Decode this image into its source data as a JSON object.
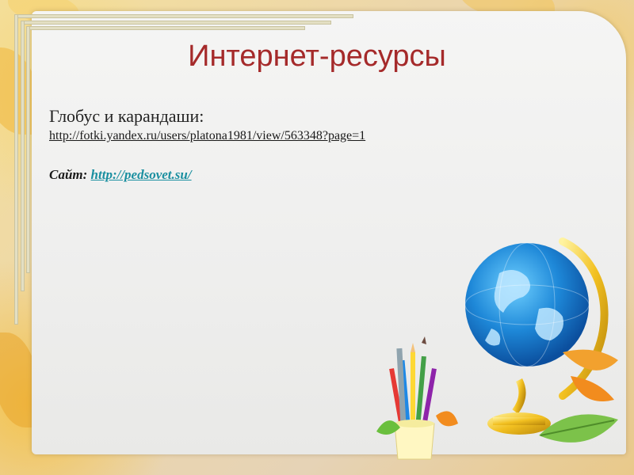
{
  "slide": {
    "title": "Интернет-ресурсы",
    "heading": "Глобус и карандаши:",
    "link1": "http://fotki.yandex.ru/users/platona1981/view/563348?page=1",
    "site_label": "Сайт:",
    "site_link": "http://pedsovet.su/"
  },
  "colors": {
    "title": "#a52a2a",
    "link_accent": "#1a8fa0"
  },
  "decorations": [
    "globe-illustration",
    "pencil-cup-illustration",
    "autumn-leaves"
  ]
}
